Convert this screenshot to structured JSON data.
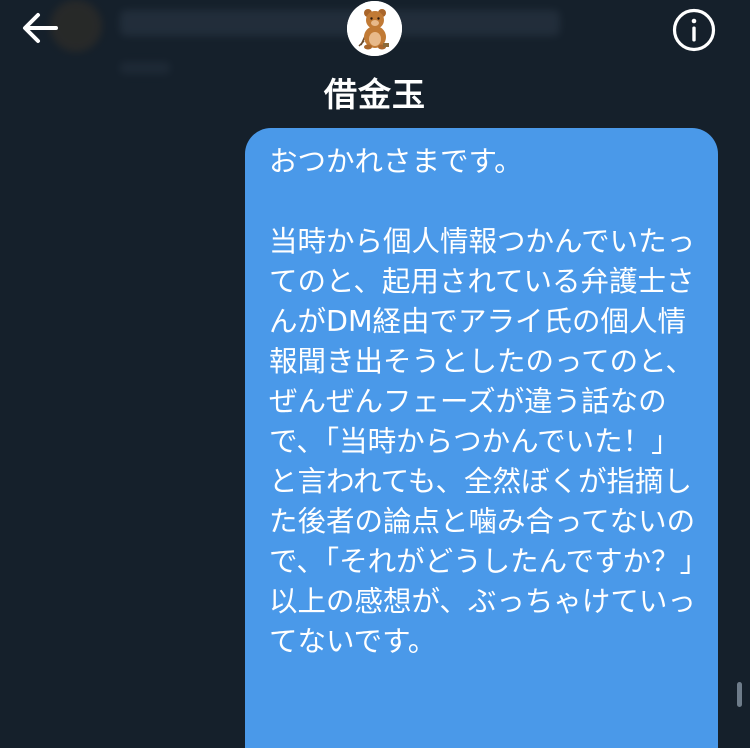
{
  "header": {
    "title": "借金玉",
    "back_icon": "arrow-left-icon",
    "info_icon": "info-circle-icon",
    "avatar_icon": "bear-avatar"
  },
  "message": {
    "text": "おつかれさまです。\n\n当時から個人情報つかんでいたってのと、起用されている弁護士さんがDM経由でアライ氏の個人情報聞き出そうとしたのってのと、ぜんぜんフェーズが違う話なので、「当時からつかんでいた！」と言われても、全然ぼくが指摘した後者の論点と噛み合ってないので、「それがどうしたんですか？」以上の感想が、ぶっちゃけていってないです。"
  },
  "colors": {
    "background": "#15202b",
    "bubble": "#4a99e9",
    "text": "#ffffff"
  }
}
